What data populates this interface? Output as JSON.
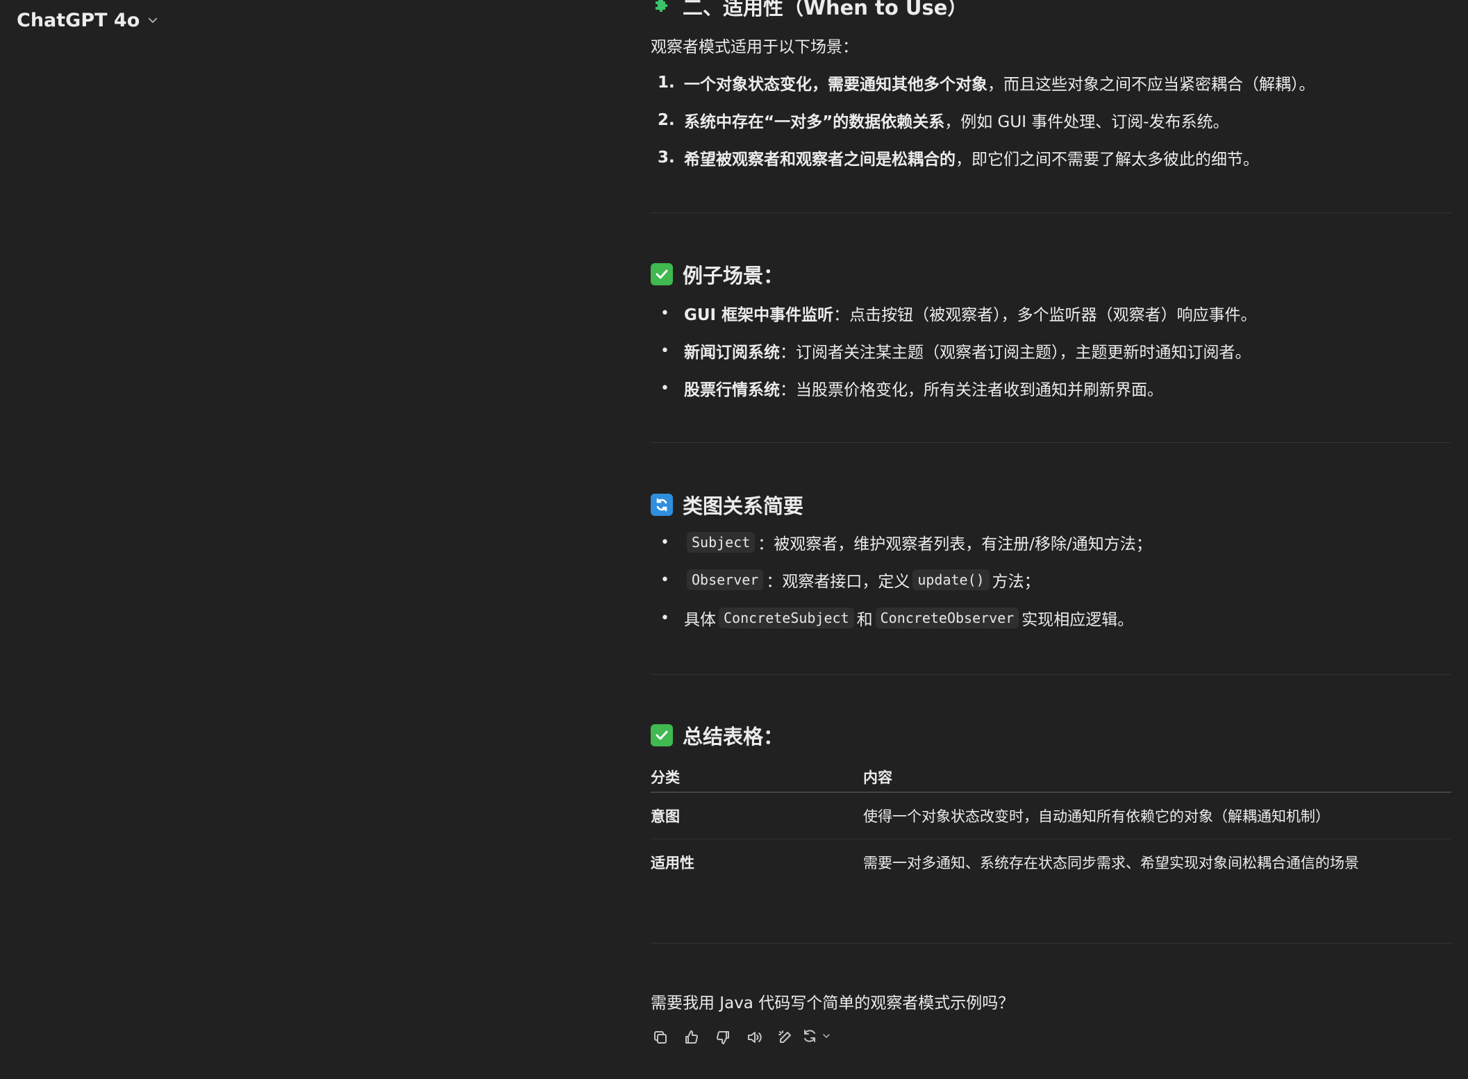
{
  "header": {
    "model_name": "ChatGPT 4o"
  },
  "colors": {
    "background": "#212121",
    "text": "#ececec",
    "check_green": "#3fb950",
    "cycle_blue": "#2f8fdd",
    "puzzle_green": "#3cc26b"
  },
  "applicability": {
    "title": "二、适用性（When to Use）",
    "title_icon": "puzzle-icon",
    "intro": "观察者模式适用于以下场景：",
    "items": [
      {
        "num": "1.",
        "bold": "一个对象状态变化，需要通知其他多个对象",
        "rest": "，而且这些对象之间不应当紧密耦合（解耦）。"
      },
      {
        "num": "2.",
        "bold": "系统中存在“一对多”的数据依赖关系",
        "rest": "，例如 GUI 事件处理、订阅-发布系统。"
      },
      {
        "num": "3.",
        "bold": "希望被观察者和观察者之间是松耦合的",
        "rest": "，即它们之间不需要了解太多彼此的细节。"
      }
    ]
  },
  "examples": {
    "title": "例子场景：",
    "title_icon": "check-mark-icon",
    "items": [
      {
        "bold": "GUI 框架中事件监听",
        "rest": "：点击按钮（被观察者），多个监听器（观察者）响应事件。"
      },
      {
        "bold": "新闻订阅系统",
        "rest": "：订阅者关注某主题（观察者订阅主题），主题更新时通知订阅者。"
      },
      {
        "bold": "股票行情系统",
        "rest": "：当股票价格变化，所有关注者收到通知并刷新界面。"
      }
    ]
  },
  "class_diagram": {
    "title": "类图关系简要",
    "title_icon": "cycle-arrows-icon",
    "item1": {
      "code": "Subject",
      "text": "：被观察者，维护观察者列表，有注册/移除/通知方法；"
    },
    "item2": {
      "code": "Observer",
      "text": "：观察者接口，定义",
      "code2": "update()",
      "text2": "方法；"
    },
    "item3": {
      "prefix": "具体",
      "code": "ConcreteSubject",
      "mid": "和",
      "code2": "ConcreteObserver",
      "suffix": "实现相应逻辑。"
    }
  },
  "summary": {
    "title": "总结表格：",
    "title_icon": "check-mark-icon",
    "headers": [
      "分类",
      "内容"
    ],
    "rows": [
      [
        "意图",
        "使得一个对象状态改变时，自动通知所有依赖它的对象（解耦通知机制）"
      ],
      [
        "适用性",
        "需要一对多通知、系统存在状态同步需求、希望实现对象间松耦合通信的场景"
      ]
    ]
  },
  "followup_question": "需要我用 Java 代码写个简单的观察者模式示例吗？",
  "actions": [
    "copy-icon",
    "thumbs-up-icon",
    "thumbs-down-icon",
    "read-aloud-icon",
    "edit-icon",
    "regenerate-icon"
  ]
}
